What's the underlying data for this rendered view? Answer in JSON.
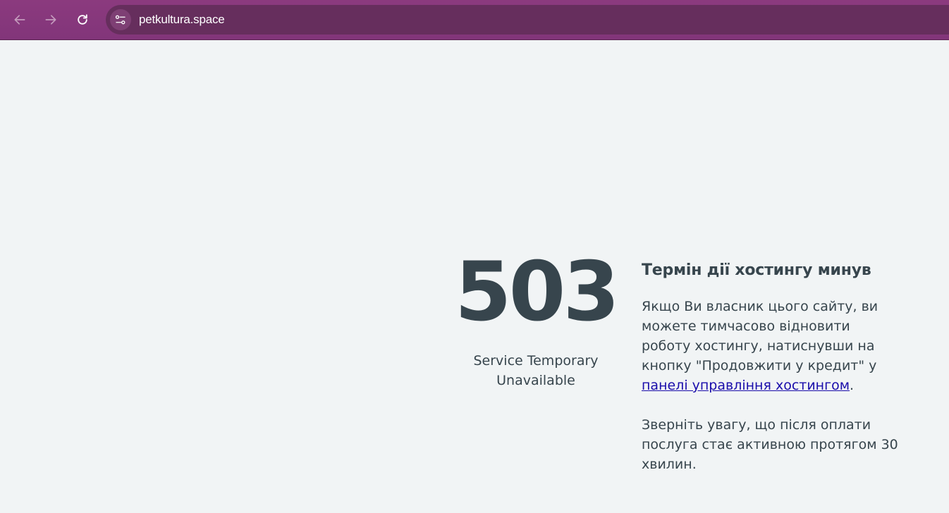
{
  "browser": {
    "url": "petkultura.space",
    "icons": {
      "back": "arrow-left-icon",
      "forward": "arrow-right-icon",
      "reload": "reload-icon",
      "site_info": "tune-icon"
    }
  },
  "error": {
    "code": "503",
    "status_line1": "Service Temporary",
    "status_line2": "Unavailable"
  },
  "message": {
    "title": "Термін дії хостингу минув",
    "paragraph1_before_link": "Якщо Ви власник цього сайту, ви можете тимчасово відновити роботу хостингу, натиснувши на кнопку \"Продовжити у кредит\" у ",
    "paragraph1_link": "панелі управління хостингом",
    "paragraph1_after_link": ".",
    "paragraph2": "Зверніть увагу, що після оплати послуга стає активною протягом 30 хвилин."
  },
  "colors": {
    "toolbar": "#8b3a7e",
    "omnibox": "#662e5d",
    "page_background": "#f1f4f5",
    "text": "#37454d",
    "link": "#1a0dab"
  }
}
